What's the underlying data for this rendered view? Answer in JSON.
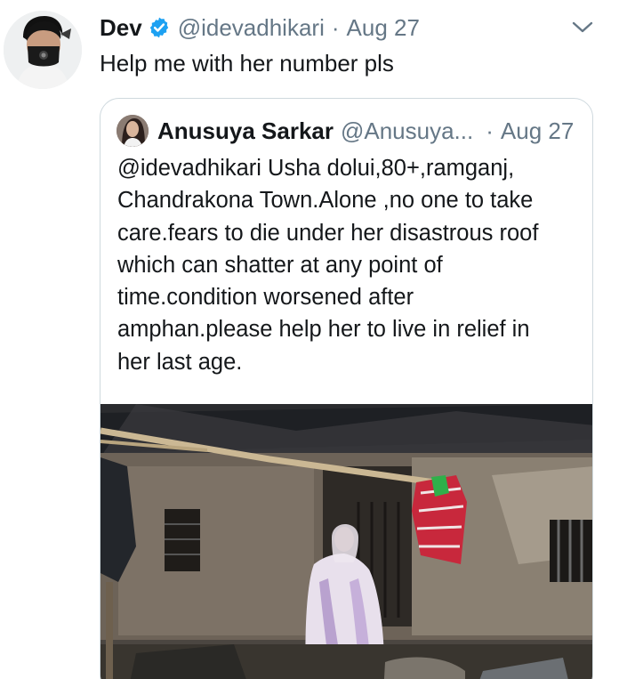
{
  "tweet": {
    "author_name": "Dev",
    "handle": "@idevadhikari",
    "separator": "·",
    "date": "Aug 27",
    "text": "Help me with her number pls",
    "avatar_icon": "user-avatar-masked-person",
    "verified_icon": "verified-badge-icon",
    "menu_icon": "chevron-down-icon"
  },
  "quoted": {
    "author_name": "Anusuya Sarkar",
    "handle": "@Anusuya...",
    "separator": "·",
    "date": "Aug 27",
    "text_lines": [
      "@idevadhikari Usha dolui,80+,ramganj,",
      "Chandrakona Town.Alone ,no one to take",
      "care.fears to die under her disastrous roof",
      "which can shatter at any point of",
      "time.condition worsened after",
      "amphan.please help her to live in relief in",
      "her last age."
    ],
    "media": "photo-elderly-woman-outside-damaged-mud-house"
  },
  "colors": {
    "text_primary": "#14171a",
    "text_secondary": "#657786",
    "verified_blue": "#1da1f2",
    "card_border": "#cfd9de"
  }
}
